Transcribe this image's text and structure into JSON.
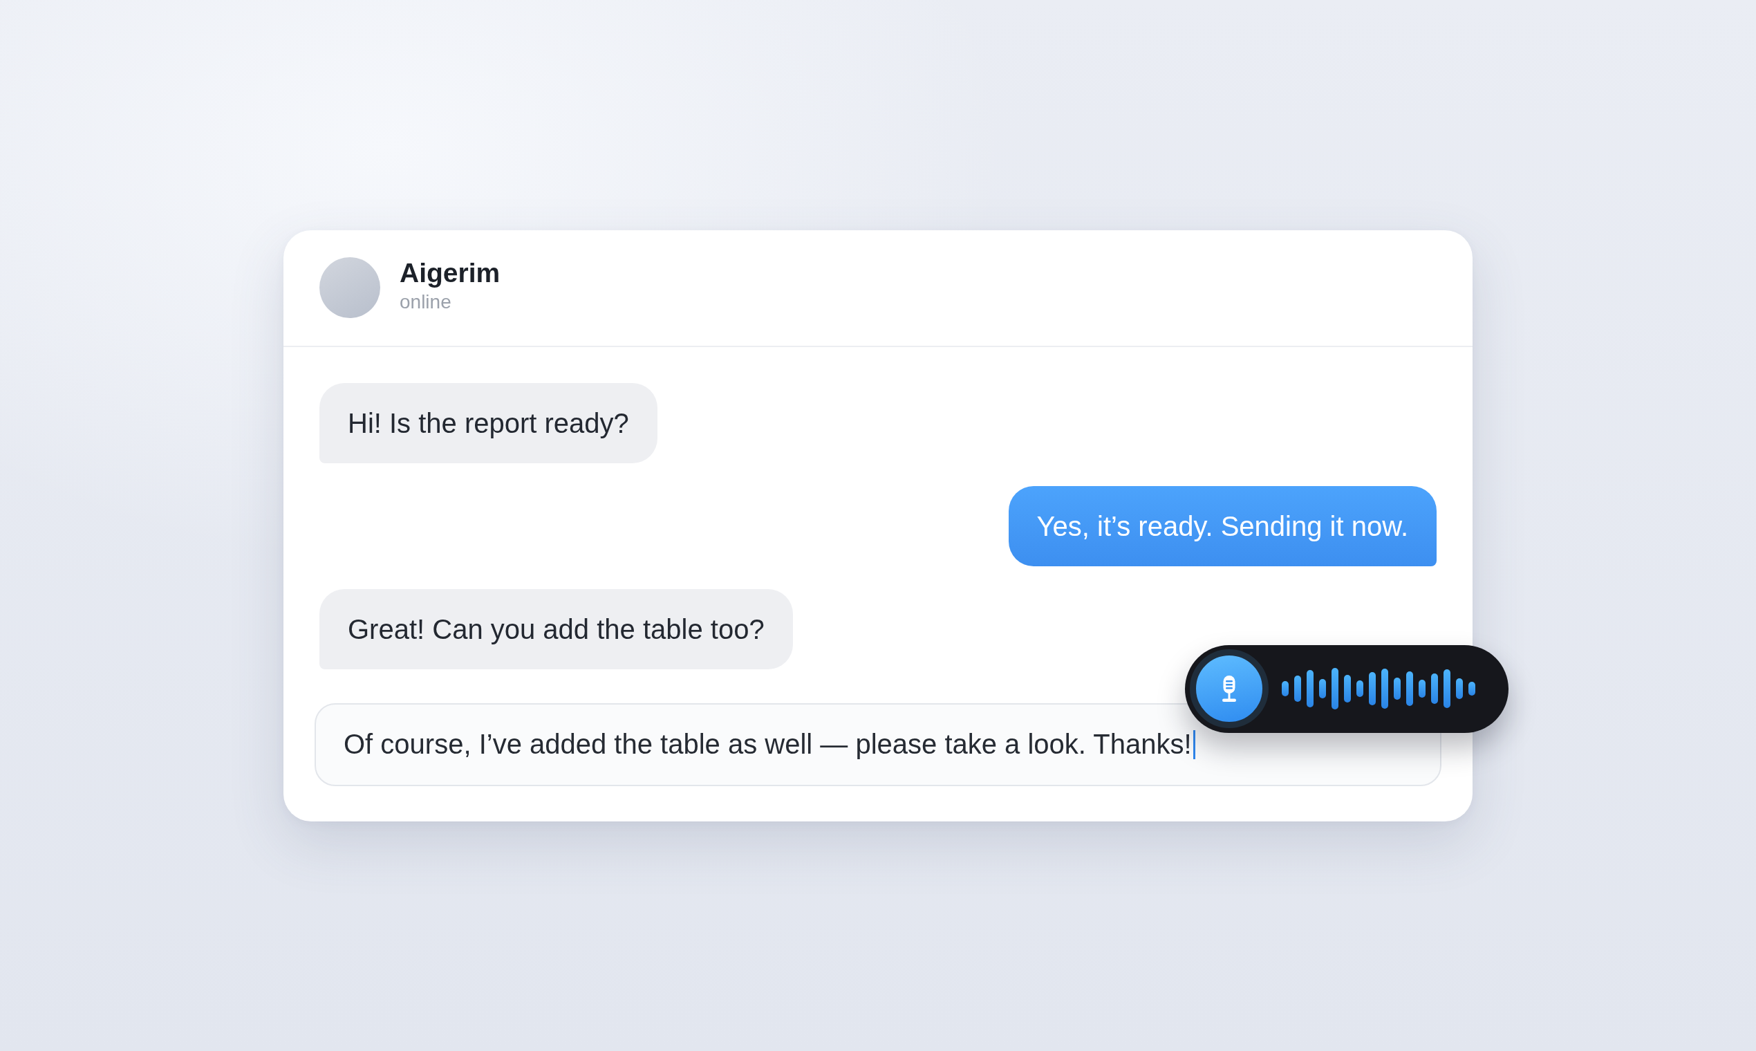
{
  "contact": {
    "name": "Aigerim",
    "status": "online"
  },
  "messages": [
    {
      "kind": "incoming",
      "text": "Hi! Is the report ready?"
    },
    {
      "kind": "outgoing",
      "text": "Yes, it’s ready. Sending it now."
    },
    {
      "kind": "incoming",
      "text": "Great! Can you add the table too?"
    }
  ],
  "composer": {
    "value": "Of course, I’ve added the table as well — please take a look. Thanks!",
    "focused": true
  },
  "voice_recorder": {
    "recording": true
  }
}
